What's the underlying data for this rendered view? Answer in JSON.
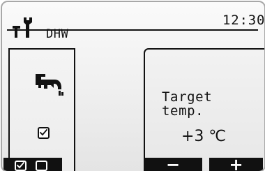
{
  "header": {
    "mode_title": "DHW",
    "time": "12:30",
    "mode_icon": "wrench-screwdriver-icon"
  },
  "left_panel": {
    "icon": "faucet-icon",
    "checkbox_icon": "checkmark-icon",
    "checked": true
  },
  "right_panel": {
    "label": "Target temp.",
    "value": "+3 ℃"
  },
  "soft_keys": {
    "left": {
      "checked_box_icon": "checkbox-checked-icon",
      "unchecked_box_icon": "checkbox-empty-icon"
    },
    "minus": {
      "label": "−"
    },
    "plus": {
      "label": "+"
    }
  }
}
